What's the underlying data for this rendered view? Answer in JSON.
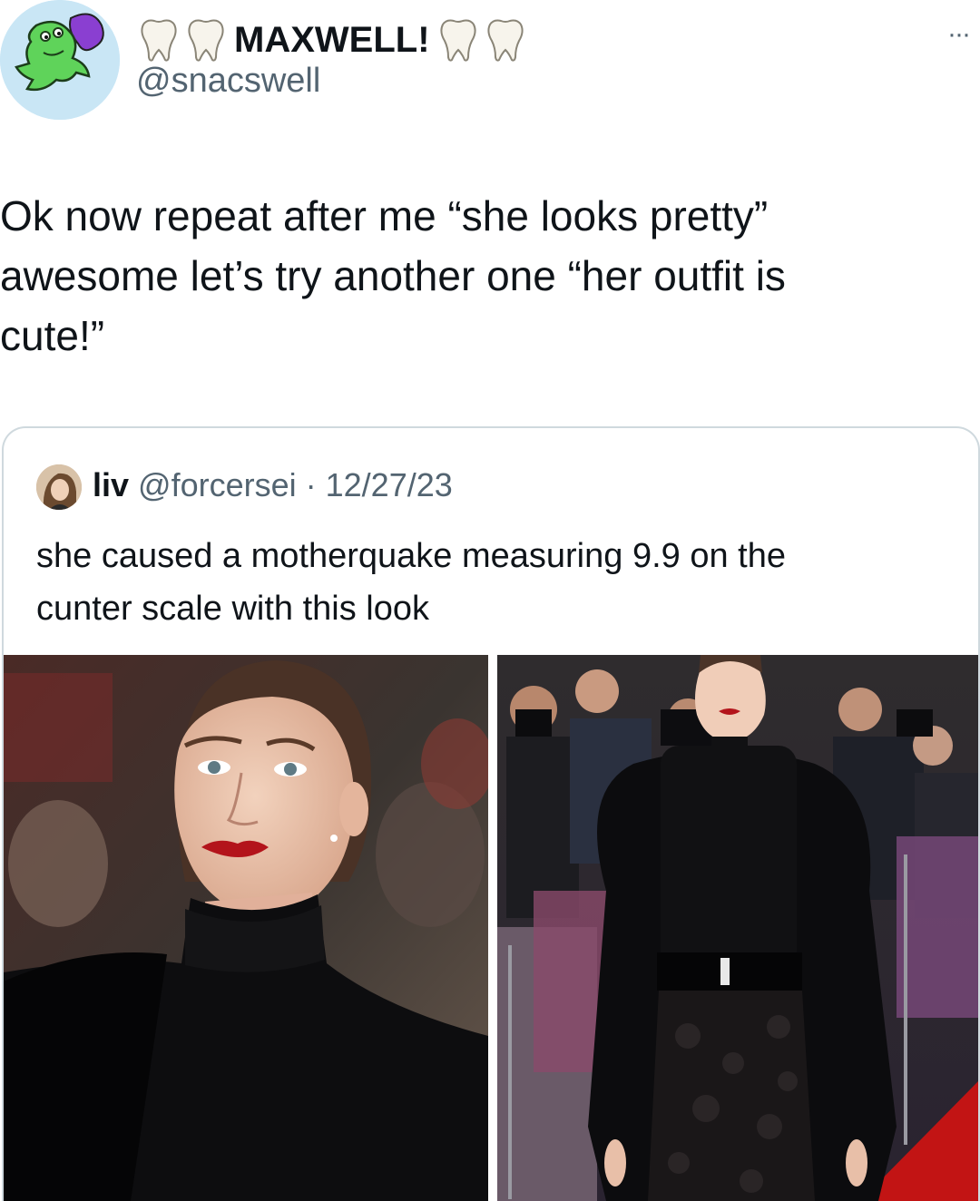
{
  "author": {
    "display_name": "MAXWELL!",
    "handle": "@snacswell",
    "avatar_icon": "green-frog-avatar-icon",
    "name_decoration_icon": "tooth-emoji-icon"
  },
  "menu": {
    "more_label": "···"
  },
  "tweet": {
    "text": "Ok now repeat after me “she looks pretty”\nawesome let’s try another one “her outfit is\ncute!”"
  },
  "quoted": {
    "name": "liv",
    "handle": "@forcersei",
    "separator": "·",
    "date": "12/27/23",
    "text": "she caused a motherquake measuring 9.9 on the\ncunter scale with this look",
    "images": [
      {
        "icon": "portrait-photo"
      },
      {
        "icon": "red-carpet-photo"
      }
    ]
  },
  "colors": {
    "text_primary": "#0f1419",
    "text_secondary": "#536471",
    "border": "#cfd9de",
    "lipstick_red": "#b3141b"
  }
}
